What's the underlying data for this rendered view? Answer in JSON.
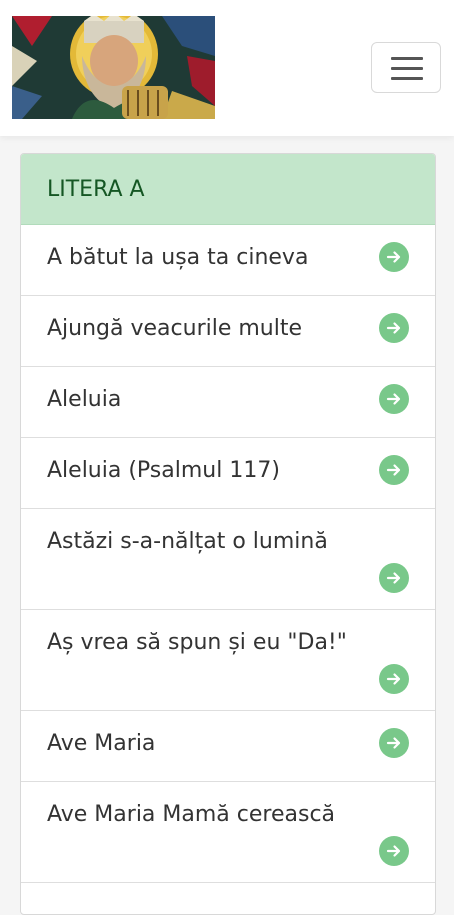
{
  "header": {
    "logo_alt": "Stained glass icon of King David with harp",
    "menu_icon": "hamburger-menu-icon"
  },
  "section": {
    "title": "LITERA A"
  },
  "songs": [
    {
      "title": "A bătut la ușa ta cineva"
    },
    {
      "title": "Ajungă veacurile multe"
    },
    {
      "title": "Aleluia"
    },
    {
      "title": "Aleluia (Psalmul 117)"
    },
    {
      "title": "Astăzi s-a-nălțat o lumină"
    },
    {
      "title": "Aș vrea să spun și eu \"Da!\""
    },
    {
      "title": "Ave Maria"
    },
    {
      "title": "Ave Maria Mamă cerească"
    }
  ],
  "colors": {
    "header_bg": "#c3e6cb",
    "header_text": "#155724",
    "arrow_icon": "#79c88a"
  }
}
